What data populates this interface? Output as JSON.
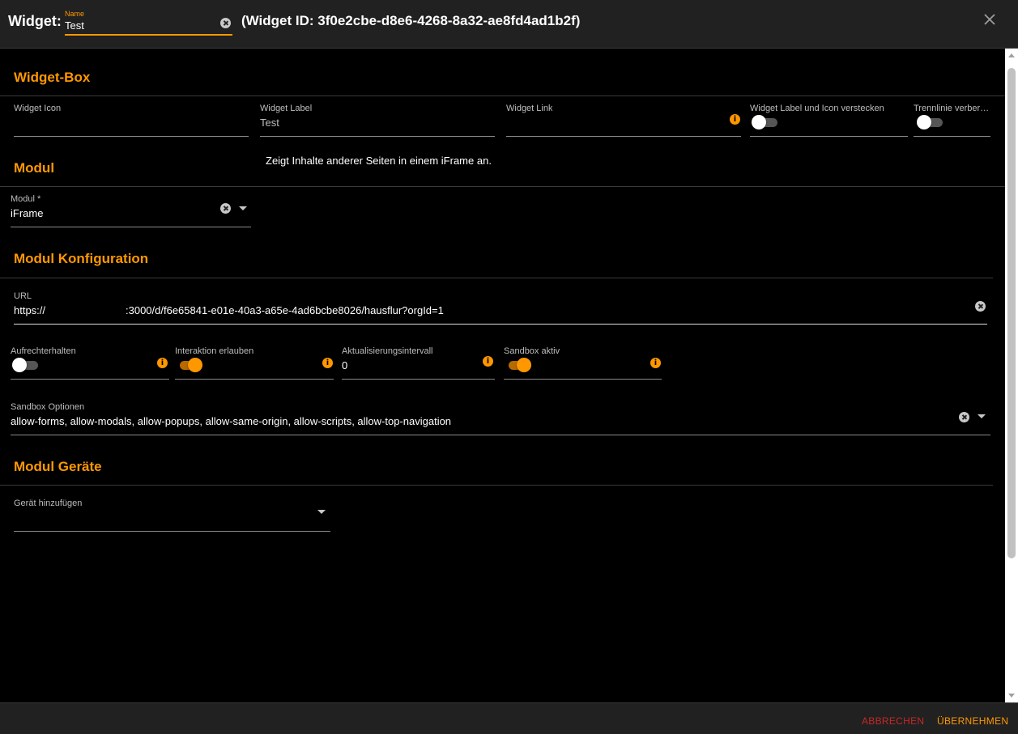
{
  "header": {
    "title": "Widget:",
    "name_label": "Name",
    "name_value": "Test",
    "widget_id": "(Widget ID: 3f0e2cbe-d8e6-4268-8a32-ae8fd4ad1b2f)"
  },
  "widget_box": {
    "heading": "Widget-Box",
    "icon_label": "Widget Icon",
    "icon_value": "",
    "label_label": "Widget Label",
    "label_value": "Test",
    "link_label": "Widget Link",
    "link_value": "",
    "hide_label": "Widget Label und Icon verstecken",
    "hide_on": false,
    "divider_label": "Trennlinie verber…",
    "divider_on": false
  },
  "modul": {
    "heading": "Modul",
    "label": "Modul *",
    "value": "iFrame",
    "description": "Zeigt Inhalte anderer Seiten in einem iFrame an."
  },
  "config": {
    "heading": "Modul Konfiguration",
    "url_label": "URL",
    "url_prefix": "https://",
    "url_value": ":3000/d/f6e65841-e01e-40a3-a65e-4ad6bcbe8026/hausflur?orgId=1",
    "keep_label": "Aufrechterhalten",
    "keep_on": false,
    "interact_label": "Interaktion erlauben",
    "interact_on": true,
    "interval_label": "Aktualisierungsintervall",
    "interval_value": "0",
    "sandbox_label": "Sandbox aktiv",
    "sandbox_on": true,
    "sandbox_opts_label": "Sandbox Optionen",
    "sandbox_opts_value": "allow-forms, allow-modals, allow-popups, allow-same-origin, allow-scripts, allow-top-navigation"
  },
  "devices": {
    "heading": "Modul Geräte",
    "add_label": "Gerät hinzufügen",
    "add_value": ""
  },
  "footer": {
    "cancel": "ABBRECHEN",
    "apply": "ÜBERNEHMEN"
  },
  "colors": {
    "accent": "#ff9800",
    "cancel": "#c62828",
    "background": "#000000",
    "bar": "#212121"
  }
}
